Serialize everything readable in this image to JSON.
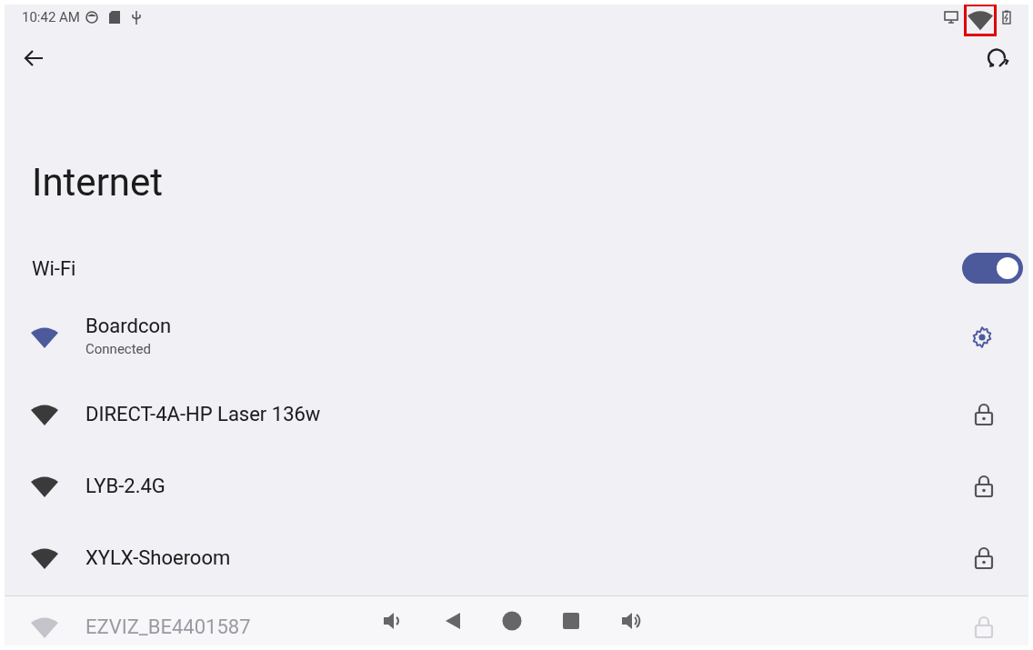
{
  "status_bar": {
    "time": "10:42 AM"
  },
  "title": "Internet",
  "wifi": {
    "label": "Wi-Fi",
    "on": true
  },
  "networks": [
    {
      "name": "Boardcon",
      "status": "Connected",
      "kind": "connected"
    },
    {
      "name": "DIRECT-4A-HP Laser 136w",
      "kind": "secured"
    },
    {
      "name": "LYB-2.4G",
      "kind": "secured"
    },
    {
      "name": "XYLX-Shoeroom",
      "kind": "secured"
    },
    {
      "name": "EZVIZ_BE4401587",
      "kind": "secured"
    }
  ]
}
